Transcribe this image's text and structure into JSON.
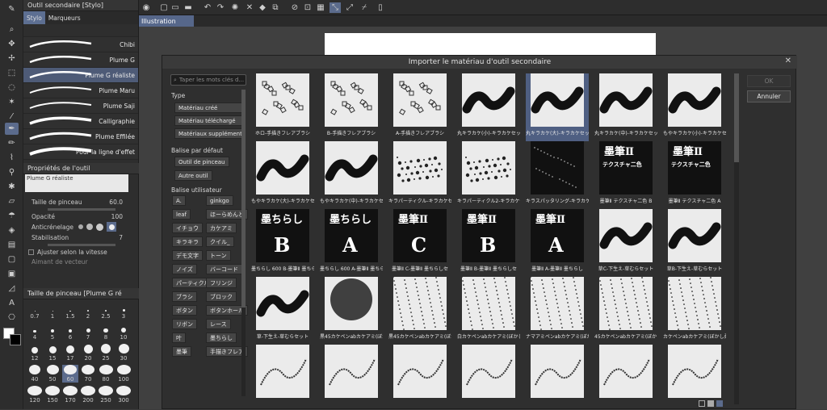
{
  "subtool_panel": {
    "title": "Outil secondaire [Stylo]",
    "tabs": [
      "Stylo",
      "Marqueurs"
    ]
  },
  "brushes": [
    {
      "name": "Chibi"
    },
    {
      "name": "Plume G"
    },
    {
      "name": "Plume G réaliste",
      "selected": true
    },
    {
      "name": "Plume Maru"
    },
    {
      "name": "Plume Saji"
    },
    {
      "name": "Calligraphie"
    },
    {
      "name": "Plume Effilée"
    },
    {
      "name": "Pour la ligne d'effet"
    }
  ],
  "properties": {
    "title": "Propriétés de l'outil",
    "tool_name": "Plume G réaliste",
    "size_label": "Taille de pinceau",
    "size_value": "60.0",
    "opacity_label": "Opacité",
    "opacity_value": "100",
    "antialias_label": "Anticrénelage",
    "stab_label": "Stabilisation",
    "stab_value": "7",
    "speed_label": "Ajuster selon la vitesse",
    "vector_label": "Aimant de vecteur"
  },
  "size_panel": {
    "title": "Taille de pinceau [Plume G ré",
    "sizes": [
      "0.7",
      "1",
      "1.5",
      "2",
      "2.5",
      "3",
      "4",
      "5",
      "6",
      "7",
      "8",
      "10",
      "12",
      "15",
      "17",
      "20",
      "25",
      "30",
      "40",
      "50",
      "60",
      "70",
      "80",
      "100",
      "120",
      "150",
      "170",
      "200",
      "250",
      "300"
    ],
    "selected": "60"
  },
  "document_tab": "Illustration",
  "dialog": {
    "title": "Importer le matériau d'outil secondaire",
    "search_placeholder": "Taper les mots clés d...",
    "type_label": "Type",
    "type_buttons": [
      "Matériau créé",
      "Matériau téléchargé",
      "Matériaux supplémentai"
    ],
    "default_tag_label": "Balise par défaut",
    "default_tags": [
      "Outil de pinceau",
      "Autre outil"
    ],
    "user_tag_label": "Balise utilisateur",
    "user_tags": [
      "A.",
      "ginkgo",
      "leaf",
      "ほーらめんと",
      "イチョウ",
      "カケアミ",
      "キラキラ",
      "クイル_",
      "デモ文字",
      "トーン",
      "ノイズ",
      "バーコード",
      "パーティクル",
      "フリンジ",
      "ブラシ",
      "ブロック",
      "ボタン",
      "ボタンホール",
      "リボン",
      "レース",
      "叶",
      "墨ちらし",
      "墨筆",
      "手描きフレア"
    ],
    "ok": "OK",
    "cancel": "Annuler",
    "materials": [
      "ホロ-手描きフレアブラシ",
      "B-手描きフレアブラシ",
      "A-手描きフレアブラシ",
      "丸キラカケ(小)-キラカケセット",
      "丸キラカケ(大)-キラカケセット",
      "丸キラカケ(中)-キラカケセット",
      "もやキラカケ(小)-キラカケセット",
      "もやキラカケ(大)-キラカケセット",
      "もやキラカケ(中)-キラカケセット",
      "キラパーティクル-キラカケセット",
      "キラパーティクル2-キラカケセット",
      "キラスパッタリング-キラカケセット",
      "墨筆Ⅱ テクスチャ二色 B",
      "墨筆Ⅱ テクスチャ二色 A",
      "墨ちらし 600 B-墨筆Ⅱ 墨ちら",
      "墨ちらし 600 A-墨筆Ⅱ 墨ちら",
      "墨筆Ⅱ C-墨筆Ⅱ 墨ちらしセ",
      "墨筆Ⅱ B-墨筆Ⅱ 墨ちらしセ",
      "墨筆Ⅱ A-墨筆Ⅱ 墨ちらし",
      "草C-下生え-草むらセット",
      "草B-下生え-草むらセット",
      "草-下生え-草むらセット",
      "黒45カケペンabカケアミ(ぼかし柔",
      "黒45カケペンabカケアミ(ぼかし柔",
      "白カケペンabカケアミ(ぼかし柔",
      "ナマアミペンabカケアミ(ぼかし柔",
      "45カケペンabカケアミ(ぼかし柔",
      "カケペンabカケアミ(ぼかし柔",
      "",
      "",
      "",
      "",
      "",
      "",
      ""
    ],
    "kanji_top": "墨筆Ⅱ",
    "kanji_scatter": "墨ちらし",
    "kanji_sub": "テクスチャ二色",
    "letters": [
      "B",
      "A",
      "C",
      "B",
      "A"
    ]
  }
}
